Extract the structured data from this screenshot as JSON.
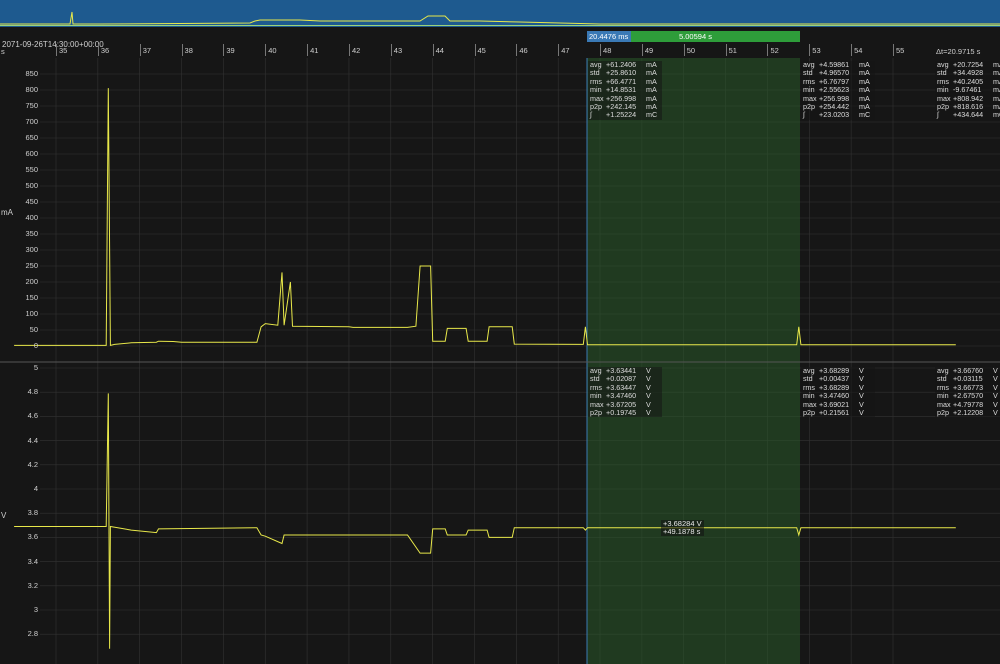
{
  "timestamp": "2071-09-26T14:30:00+00:00",
  "x_unit": "s",
  "x_ticks": [
    "35",
    "36",
    "37",
    "38",
    "39",
    "40",
    "41",
    "42",
    "43",
    "44",
    "45",
    "46",
    "47",
    "48",
    "49",
    "50",
    "51",
    "52",
    "53",
    "54",
    "55"
  ],
  "selection": {
    "delta_label": "20.4476 ms",
    "duration_label": "5.00594 s"
  },
  "dt_label": "Δt=20.9715 s",
  "colors": {
    "trace": "#e8e84a",
    "selection": "#2e9d3a",
    "overview": "#1e5a8f",
    "marker": "#3a79b5"
  },
  "current_plot": {
    "unit": "mA",
    "y_ticks": [
      "850",
      "800",
      "750",
      "700",
      "650",
      "600",
      "550",
      "500",
      "450",
      "400",
      "350",
      "300",
      "250",
      "200",
      "150",
      "100",
      "50",
      "0"
    ],
    "stats_selection": [
      {
        "k": "avg",
        "v": "+61.2406",
        "u": "mA"
      },
      {
        "k": "std",
        "v": "+25.8610",
        "u": "mA"
      },
      {
        "k": "rms",
        "v": "+66.4771",
        "u": "mA"
      },
      {
        "k": "min",
        "v": "+14.8531",
        "u": "mA"
      },
      {
        "k": "max",
        "v": "+256.998",
        "u": "mA"
      },
      {
        "k": "p2p",
        "v": "+242.145",
        "u": "mA"
      },
      {
        "k": "∫",
        "v": "+1.25224",
        "u": "mC"
      }
    ],
    "stats_after": [
      {
        "k": "avg",
        "v": "+4.59861",
        "u": "mA"
      },
      {
        "k": "std",
        "v": "+4.96570",
        "u": "mA"
      },
      {
        "k": "rms",
        "v": "+6.76797",
        "u": "mA"
      },
      {
        "k": "min",
        "v": "+2.55623",
        "u": "mA"
      },
      {
        "k": "max",
        "v": "+256.998",
        "u": "mA"
      },
      {
        "k": "p2p",
        "v": "+254.442",
        "u": "mA"
      },
      {
        "k": "∫",
        "v": "+23.0203",
        "u": "mC"
      }
    ],
    "stats_total": [
      {
        "k": "avg",
        "v": "+20.7254",
        "u": "mA"
      },
      {
        "k": "std",
        "v": "+34.4928",
        "u": "mA"
      },
      {
        "k": "rms",
        "v": "+40.2405",
        "u": "mA"
      },
      {
        "k": "min",
        "v": "-9.67461",
        "u": "mA"
      },
      {
        "k": "max",
        "v": "+808.942",
        "u": "mA"
      },
      {
        "k": "p2p",
        "v": "+818.616",
        "u": "mA"
      },
      {
        "k": "∫",
        "v": "+434.644",
        "u": "mC"
      }
    ]
  },
  "voltage_plot": {
    "unit": "V",
    "y_ticks": [
      "5",
      "4.8",
      "4.6",
      "4.4",
      "4.2",
      "4",
      "3.8",
      "3.6",
      "3.4",
      "3.2",
      "3",
      "2.8"
    ],
    "stats_selection": [
      {
        "k": "avg",
        "v": "+3.63441",
        "u": "V"
      },
      {
        "k": "std",
        "v": "+0.02087",
        "u": "V"
      },
      {
        "k": "rms",
        "v": "+3.63447",
        "u": "V"
      },
      {
        "k": "min",
        "v": "+3.47460",
        "u": "V"
      },
      {
        "k": "max",
        "v": "+3.67205",
        "u": "V"
      },
      {
        "k": "p2p",
        "v": "+0.19745",
        "u": "V"
      }
    ],
    "stats_after": [
      {
        "k": "avg",
        "v": "+3.68289",
        "u": "V"
      },
      {
        "k": "std",
        "v": "+0.00437",
        "u": "V"
      },
      {
        "k": "rms",
        "v": "+3.68289",
        "u": "V"
      },
      {
        "k": "min",
        "v": "+3.47460",
        "u": "V"
      },
      {
        "k": "max",
        "v": "+3.69021",
        "u": "V"
      },
      {
        "k": "p2p",
        "v": "+0.21561",
        "u": "V"
      }
    ],
    "stats_total": [
      {
        "k": "avg",
        "v": "+3.66760",
        "u": "V"
      },
      {
        "k": "std",
        "v": "+0.03115",
        "u": "V"
      },
      {
        "k": "rms",
        "v": "+3.66773",
        "u": "V"
      },
      {
        "k": "min",
        "v": "+2.67570",
        "u": "V"
      },
      {
        "k": "max",
        "v": "+4.79778",
        "u": "V"
      },
      {
        "k": "p2p",
        "v": "+2.12208",
        "u": "V"
      }
    ],
    "cursor_value": "+3.68284 V",
    "cursor_time": "+49.1878 s"
  }
}
